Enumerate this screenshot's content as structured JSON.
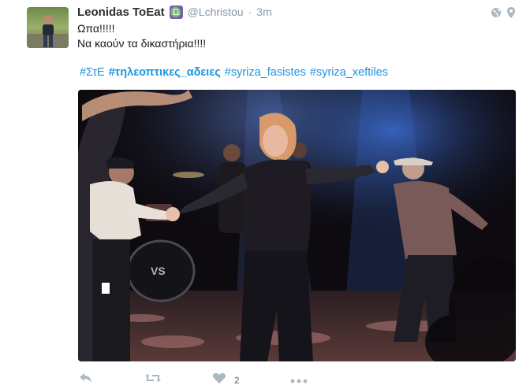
{
  "tweet": {
    "name": "Leonidas ToEat",
    "zodiac_icon": "libra-sign-icon",
    "handle": "@Lchristou",
    "separator": "·",
    "time": "3m",
    "lines": [
      "Ωπα!!!!!",
      "Να καούν τα δικαστήρια!!!!"
    ],
    "hashtags": [
      {
        "text": "#ΣτΕ",
        "bold": false
      },
      {
        "text": "#τηλεοπτικες_αδειες",
        "bold": true
      },
      {
        "text": "#syriza_fasistes",
        "bold": false
      },
      {
        "text": "#syriza_xeftiles",
        "bold": false
      }
    ],
    "actions": {
      "reply_icon": "reply-icon",
      "retweet_icon": "retweet-icon",
      "like_icon": "heart-icon",
      "like_count": "2",
      "more_icon": "more-dots-icon"
    },
    "top_icons": [
      "globe-icon",
      "location-pin-icon"
    ]
  },
  "colors": {
    "link": "#1b95e0",
    "muted": "#8899a6",
    "zodiac": "#8b4fc6"
  }
}
